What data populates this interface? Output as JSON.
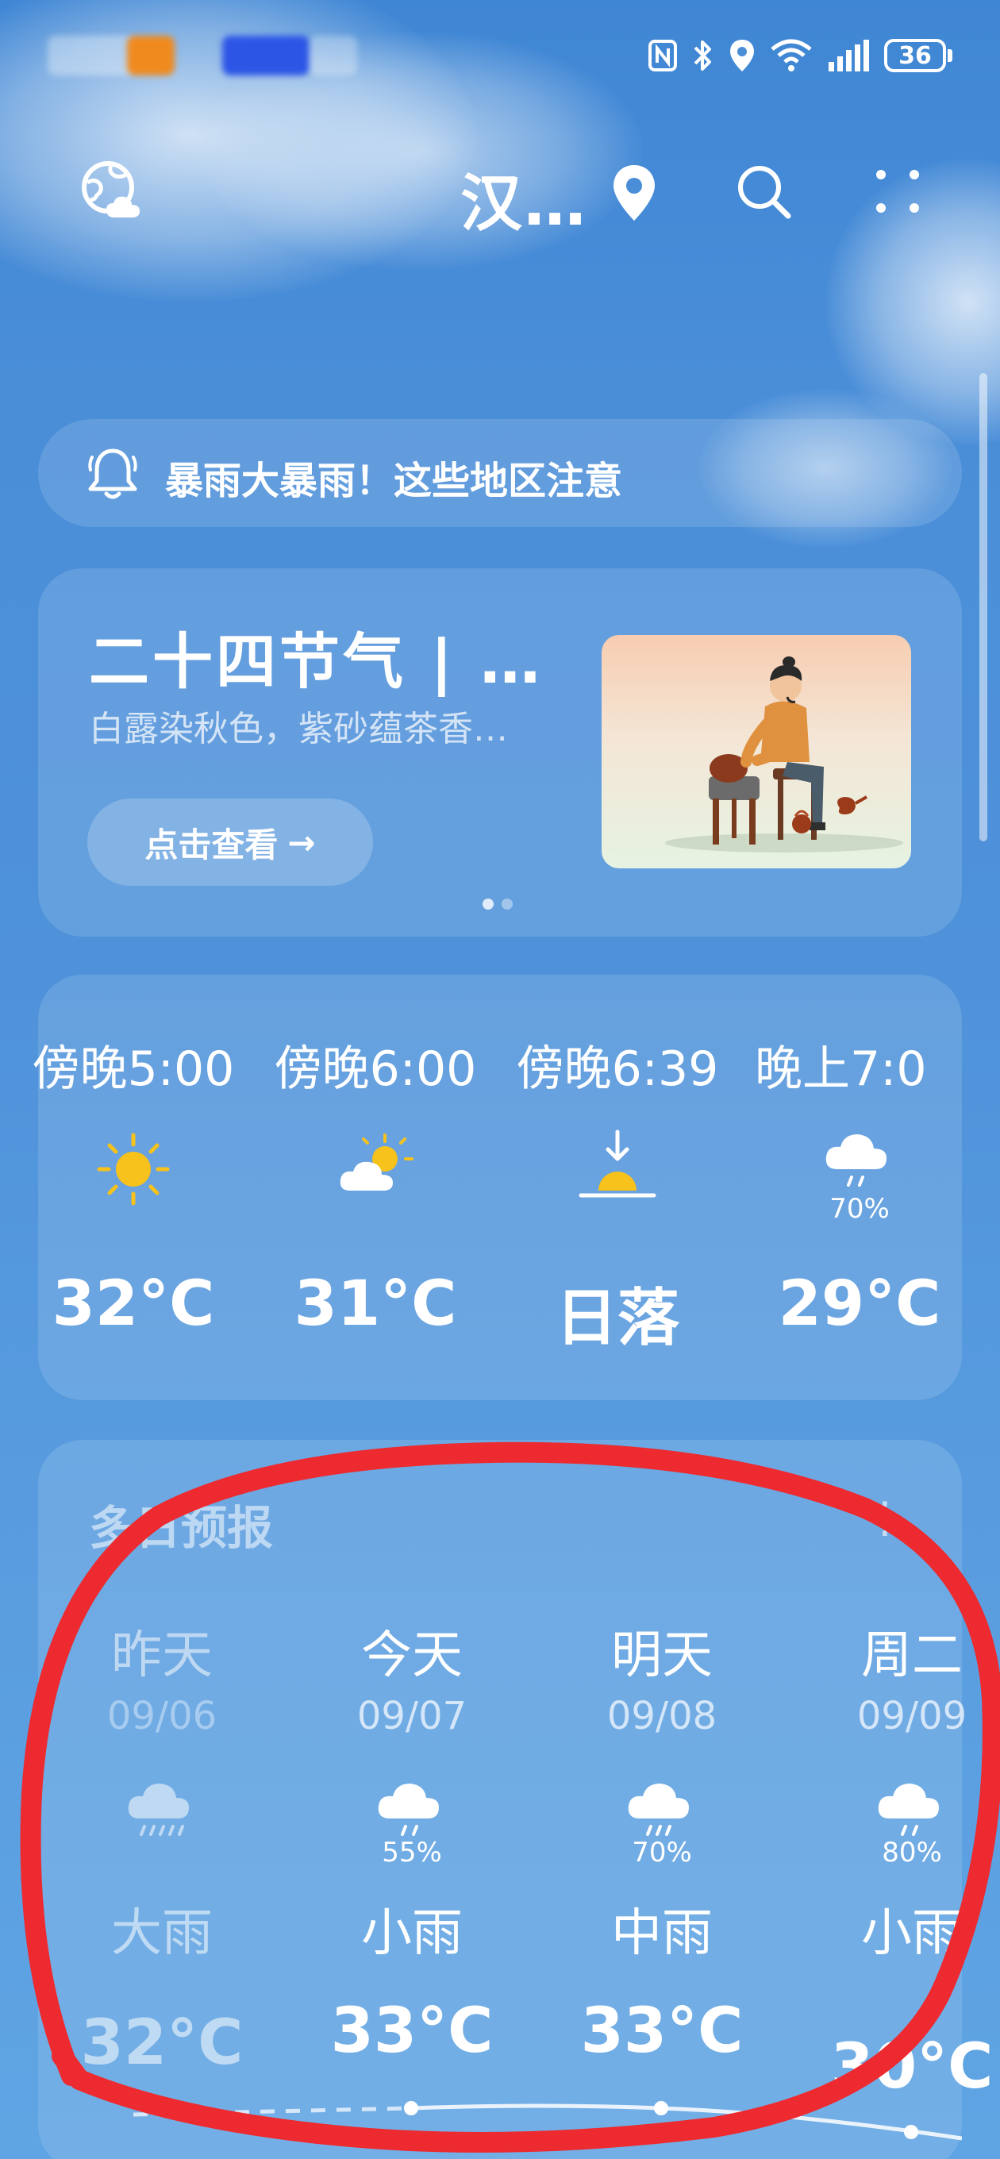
{
  "status_bar": {
    "battery_level": "36",
    "icons": [
      "nfc-icon",
      "bluetooth-icon",
      "location-icon",
      "wifi-icon",
      "signal-icon",
      "battery-icon"
    ]
  },
  "header": {
    "city": "汉…",
    "icons": [
      "globe-cloud-icon",
      "location-pin-icon",
      "search-icon",
      "more-icon"
    ]
  },
  "alert": {
    "text": "暴雨大暴雨！这些地区注意"
  },
  "promo": {
    "title": "二十四节气 | …",
    "subtitle": "白露染秋色，紫砂蕴茶香…",
    "button_label": "点击查看",
    "button_arrow": "→",
    "page_count": 2,
    "active_page": 1
  },
  "hourly": [
    {
      "time": "傍晚5:00",
      "icon": "sun-icon",
      "precip": "",
      "value": "32°C"
    },
    {
      "time": "傍晚6:00",
      "icon": "partly-cloudy-icon",
      "precip": "",
      "value": "31°C"
    },
    {
      "time": "傍晚6:39",
      "icon": "sunset-icon",
      "precip": "",
      "value": "日落"
    },
    {
      "time": "晚上7:0",
      "icon": "light-rain-icon",
      "precip": "70%",
      "value": "29°C"
    }
  ],
  "forecast": {
    "title": "多日预报",
    "more": "⋮",
    "days": [
      {
        "day": "昨天",
        "date": "09/06",
        "icon": "heavy-rain-icon",
        "precip": "",
        "condition": "大雨",
        "temp": "32°C"
      },
      {
        "day": "今天",
        "date": "09/07",
        "icon": "light-rain-icon",
        "precip": "55%",
        "condition": "小雨",
        "temp": "33°C"
      },
      {
        "day": "明天",
        "date": "09/08",
        "icon": "moderate-rain-icon",
        "precip": "70%",
        "condition": "中雨",
        "temp": "33°C"
      },
      {
        "day": "周二",
        "date": "09/09",
        "icon": "light-rain-icon",
        "precip": "80%",
        "condition": "小雨",
        "temp": "30°C"
      }
    ]
  },
  "colors": {
    "background_top": "#3f86d4",
    "background_bottom": "#5fa4e3",
    "sun": "#f7c21b",
    "annotation": "#ec2a2f"
  }
}
